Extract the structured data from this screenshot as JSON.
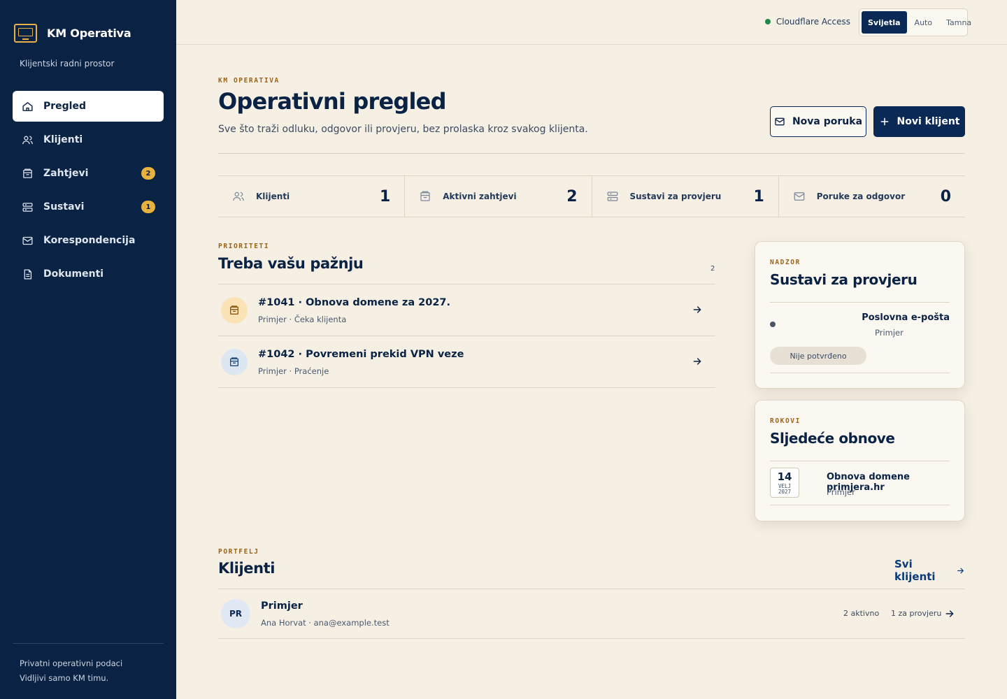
{
  "sidebar": {
    "brand": "KM Operativa",
    "subtitle": "Klijentski radni prostor",
    "items": [
      {
        "label": "Pregled",
        "icon": "home-icon",
        "badge": ""
      },
      {
        "label": "Klijenti",
        "icon": "users-icon",
        "badge": ""
      },
      {
        "label": "Zahtjevi",
        "icon": "inbox-icon",
        "badge": "2"
      },
      {
        "label": "Sustavi",
        "icon": "server-icon",
        "badge": "1"
      },
      {
        "label": "Korespondencija",
        "icon": "mail-icon",
        "badge": ""
      },
      {
        "label": "Dokumenti",
        "icon": "document-icon",
        "badge": ""
      }
    ],
    "footer_line1": "Privatni operativni podaci",
    "footer_line2": "Vidljivi samo KM timu."
  },
  "topbar": {
    "access_label": "Cloudflare Access",
    "theme_options": [
      "Svijetla",
      "Auto",
      "Tamna"
    ],
    "theme_selected": "Svijetla"
  },
  "hero": {
    "eyebrow": "KM OPERATIVA",
    "title": "Operativni pregled",
    "description": "Sve što traži odluku, odgovor ili provjeru, bez prolaska kroz svakog klijenta.",
    "btn_message": "Nova poruka",
    "btn_client": "Novi klijent"
  },
  "stats": [
    {
      "label": "Klijenti",
      "value": "1",
      "icon": "users-icon"
    },
    {
      "label": "Aktivni zahtjevi",
      "value": "2",
      "icon": "inbox-icon"
    },
    {
      "label": "Sustavi za provjeru",
      "value": "1",
      "icon": "server-icon"
    },
    {
      "label": "Poruke za odgovor",
      "value": "0",
      "icon": "mail-icon"
    }
  ],
  "priorities": {
    "eyebrow": "PRIORITETI",
    "title": "Treba vašu pažnju",
    "count": "2",
    "items": [
      {
        "title": "#1041 · Obnova domene za 2027.",
        "sub": "Primjer · Čeka klijenta",
        "tone": "#fbe3b5"
      },
      {
        "title": "#1042 · Povremeni prekid VPN veze",
        "sub": "Primjer · Praćenje",
        "tone": "#dde7f2"
      }
    ]
  },
  "systems_card": {
    "eyebrow": "NADZOR",
    "title": "Sustavi za provjeru",
    "system_name": "Poslovna e-pošta",
    "system_client": "Primjer",
    "status": "Nije potvrđeno"
  },
  "renewals_card": {
    "eyebrow": "ROKOVI",
    "title": "Sljedeće obnove",
    "day": "14",
    "month": "VELJ",
    "year": "2027",
    "name": "Obnova domene primjera.hr",
    "client": "Primjer"
  },
  "portfolio": {
    "eyebrow": "PORTFELJ",
    "title": "Klijenti",
    "all_link": "Svi klijenti",
    "client": {
      "initials": "PR",
      "name": "Primjer",
      "contact": "Ana Horvat · ana@example.test",
      "active": "2 aktivno",
      "review": "1 za provjeru"
    }
  }
}
